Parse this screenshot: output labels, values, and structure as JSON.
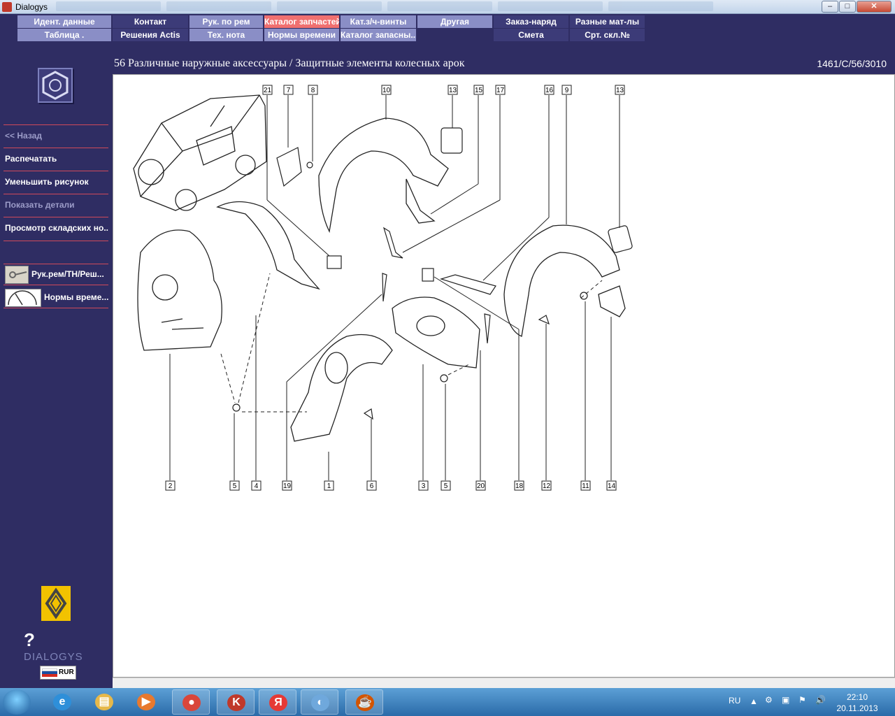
{
  "window": {
    "title": "Dialogys",
    "minimize": "–",
    "maximize": "□",
    "close": "✕"
  },
  "menu": {
    "row1": [
      {
        "label": "Идент. данные",
        "style": "light"
      },
      {
        "label": "Контакт",
        "style": "dark"
      },
      {
        "label": "Рук. по рем",
        "style": "light"
      },
      {
        "label": "Каталог запчастей",
        "style": "active"
      },
      {
        "label": "Кат.з/ч-винты",
        "style": "light"
      },
      {
        "label": "Другая",
        "style": "light"
      },
      {
        "label": "Заказ-наряд",
        "style": "dark"
      },
      {
        "label": "Разные мат-лы",
        "style": "dark"
      }
    ],
    "row2": [
      {
        "label": "Таблица .",
        "style": "light"
      },
      {
        "label": "Решения Actis",
        "style": "dark"
      },
      {
        "label": "Тех. нота",
        "style": "light"
      },
      {
        "label": "Нормы времени",
        "style": "light"
      },
      {
        "label": "Каталог запасны...",
        "style": "light"
      },
      {
        "label": "Смета",
        "style": "dark"
      },
      {
        "label": "Срт. скл.№",
        "style": "dark"
      }
    ]
  },
  "page": {
    "heading": "56 Различные наружные аксессуары / Защитные элементы колесных арок",
    "code": "1461/C/56/3010"
  },
  "sidebar": {
    "items": [
      {
        "label": "<< Назад",
        "enabled": false
      },
      {
        "label": "Распечатать",
        "enabled": true
      },
      {
        "label": "Уменьшить рисунок",
        "enabled": true
      },
      {
        "label": "Показать детали",
        "enabled": false
      },
      {
        "label": "Просмотр складских но...",
        "enabled": true
      }
    ],
    "shortcuts": [
      {
        "label": "Рук.рем/ТН/Реш...",
        "icon": "wrench-icon"
      },
      {
        "label": "Нормы време...",
        "icon": "clock-icon"
      }
    ],
    "brand": "DIALOGYS",
    "currency": "RUR"
  },
  "diagram": {
    "callouts_top": [
      "21",
      "7",
      "8",
      "10",
      "13",
      "15",
      "17",
      "16",
      "9",
      "13"
    ],
    "callouts_bottom": [
      "2",
      "5",
      "4",
      "19",
      "1",
      "6",
      "3",
      "5",
      "20",
      "18",
      "12",
      "11",
      "14"
    ]
  },
  "taskbar": {
    "apps": [
      {
        "name": "ie-icon",
        "glyph": "e",
        "color": "#2e8fd9",
        "state": "pinned"
      },
      {
        "name": "explorer-icon",
        "glyph": "▤",
        "color": "#e6b84a",
        "state": "pinned"
      },
      {
        "name": "media-player-icon",
        "glyph": "▶",
        "color": "#e8792e",
        "state": "pinned"
      },
      {
        "name": "chrome-icon",
        "glyph": "●",
        "color": "#d9463b",
        "state": "running"
      },
      {
        "name": "kaspersky-icon",
        "glyph": "K",
        "color": "#c0392b",
        "state": "running"
      },
      {
        "name": "yandex-icon",
        "glyph": "Я",
        "color": "#e53935",
        "state": "running"
      },
      {
        "name": "volume-app-icon",
        "glyph": "◐",
        "color": "#6fa8dc",
        "state": "running"
      },
      {
        "name": "java-icon",
        "glyph": "☕",
        "color": "#d35400",
        "state": "running"
      }
    ],
    "language": "RU",
    "time": "22:10",
    "date": "20.11.2013"
  }
}
